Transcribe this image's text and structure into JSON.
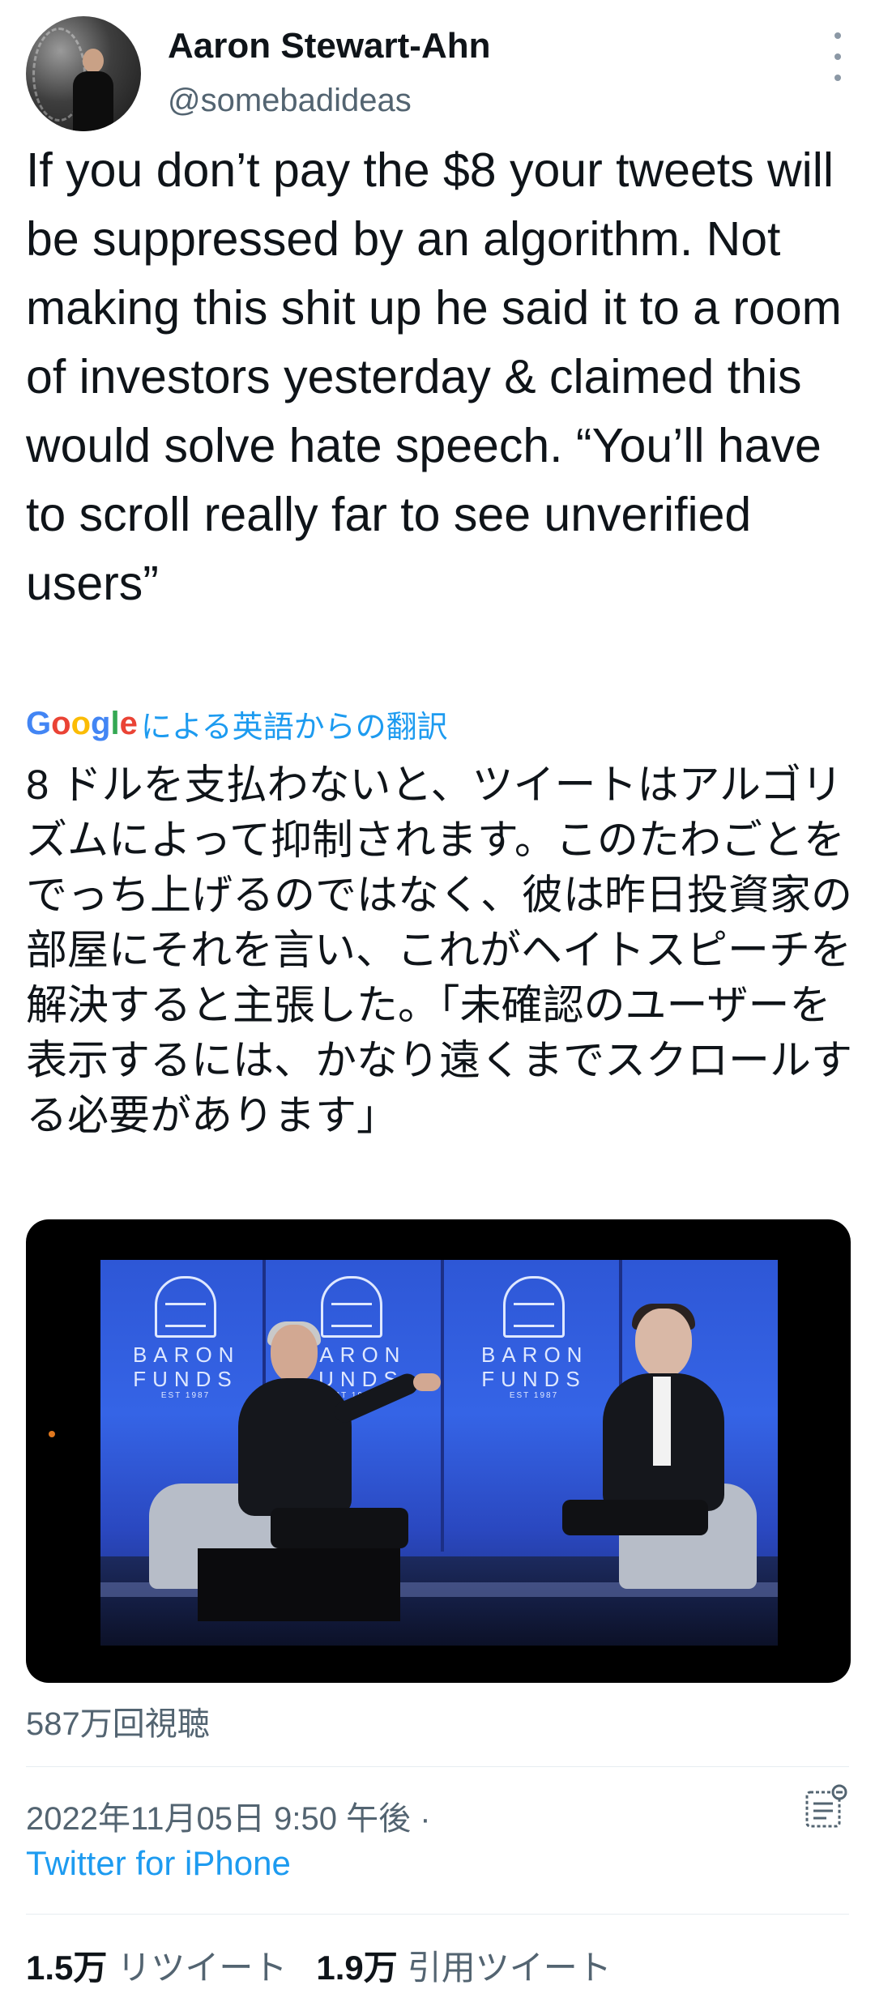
{
  "author": {
    "display_name": "Aaron Stewart-Ahn",
    "handle": "@somebadideas"
  },
  "tweet": {
    "text": "If you don’t pay the $8 your tweets will be suppressed by an algorithm. Not making this shit up he said it to a room of investors yesterday & claimed this would solve hate speech. “You’ll have to scroll really far to see unverified users”",
    "translation_label": "による英語からの翻訳",
    "translation_provider": "Google",
    "translated_text": "8 ドルを支払わないと、ツイートはアルゴリズムによって抑制されます。このたわごとをでっち上げるのではなく、彼は昨日投資家の部屋にそれを言い、これがヘイトスピーチを解決すると主張した。「未確認のユーザーを表示するには、かなり遠くまでスクロールする必要があります」"
  },
  "video": {
    "logo_name_line1": "BARON",
    "logo_name_line2": "FUNDS",
    "logo_est": "EST 1987"
  },
  "meta": {
    "views": "587万回視聴",
    "timestamp": "2022年11月05日 9:50 午後 ·",
    "source": "Twitter for iPhone"
  },
  "stats": {
    "retweets_count": "1.5万",
    "retweets_label": "リツイート",
    "quotes_count": "1.9万",
    "quotes_label": "引用ツイート"
  },
  "colors": {
    "link_blue": "#1d9bf0",
    "secondary_text": "#536471",
    "primary_text": "#0f1419"
  },
  "icons": {
    "more": "more-vertical-icon",
    "analytics": "view-analytics-icon"
  }
}
